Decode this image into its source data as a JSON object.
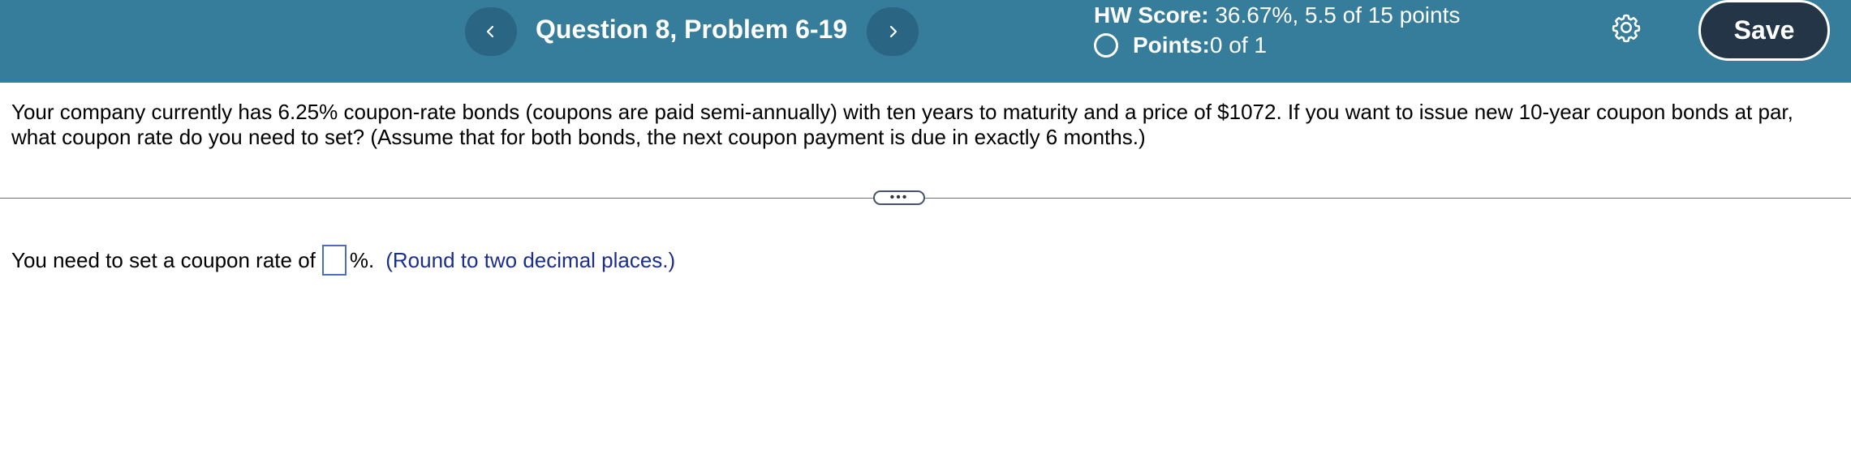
{
  "header": {
    "title": "Question 8, Problem 6-19",
    "hw_score_label": "HW Score:",
    "hw_score_value": " 36.67%, 5.5 of 15 points",
    "points_label": "Points:",
    "points_value": " 0 of 1",
    "save_label": "Save",
    "prev_icon": "chevron-left-icon",
    "next_icon": "chevron-right-icon",
    "settings_icon": "gear-icon",
    "colors": {
      "header_bg": "#367c9b",
      "nav_btn_bg": "#2a6583",
      "save_btn_bg": "#233547"
    }
  },
  "question": {
    "text": "Your company currently has 6.25% coupon-rate bonds (coupons are paid semi-annually) with ten years to maturity and a price of $1072. If you want to issue new 10-year coupon bonds at par, what coupon rate do you need to set? (Assume that for both bonds, the next coupon payment is due in exactly 6 months.)"
  },
  "expand": {
    "label": "•••"
  },
  "answer": {
    "prefix": "You need to set a coupon rate of",
    "value": "",
    "suffix": "%.",
    "hint": "(Round to two decimal places.)"
  }
}
